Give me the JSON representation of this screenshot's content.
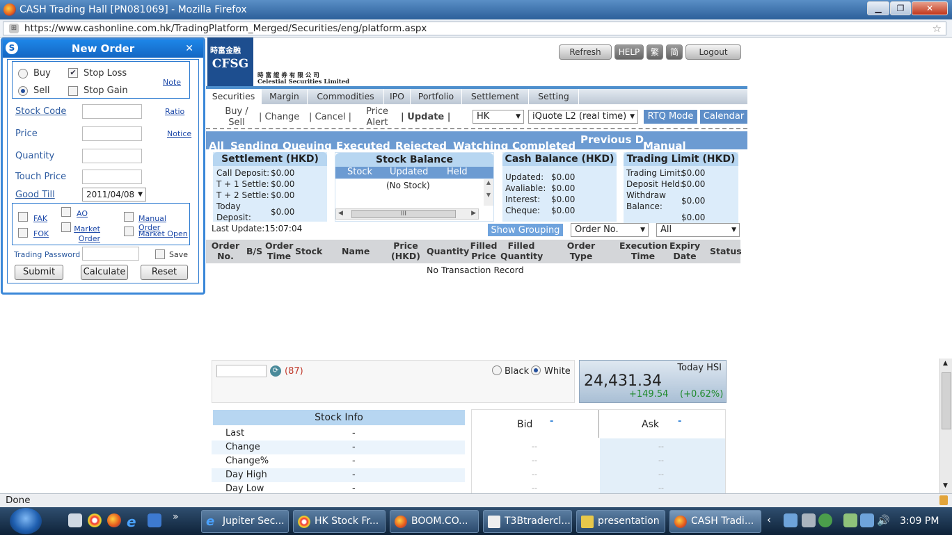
{
  "window": {
    "title": "CASH Trading Hall [PN081069] - Mozilla Firefox",
    "url": "https://www.cashonline.com.hk/TradingPlatform_Merged/Securities/eng/platform.aspx",
    "minimize": "▁",
    "restore": "❐",
    "close": "✕"
  },
  "logo": {
    "text": "CFSG",
    "cn": "時富金融",
    "company_cn": "時 富 證 券 有 限 公 司",
    "company_en": "Celestial Securities Limited"
  },
  "top_buttons": {
    "refresh": "Refresh",
    "help": "HELP",
    "trad": "繁",
    "simp": "简",
    "logout": "Logout"
  },
  "menu": [
    "Securities",
    "Margin",
    "Commodities",
    "IPO",
    "Portfolio",
    "Settlement",
    "Setting"
  ],
  "subbar": {
    "buy_sell": "Buy /\nSell",
    "change": "| Change",
    "cancel": "| Cancel |",
    "price_alert": "Price\nAlert",
    "update": "| Update |",
    "market": "HK",
    "quote": "iQuote L2 (real time)",
    "rtq": "RTQ Mode",
    "calendar": "Calendar"
  },
  "tabs": [
    "All",
    "Sending",
    "Queuing",
    "Executed",
    "Rejected",
    "Watching",
    "Completed",
    "Previous D",
    "Manual"
  ],
  "settlement": {
    "title": "Settlement (HKD)",
    "rows": [
      {
        "label": "Call Deposit:",
        "value": "$0.00"
      },
      {
        "label": "T + 1 Settle:",
        "value": "$0.00"
      },
      {
        "label": "T + 2 Settle:",
        "value": "$0.00"
      },
      {
        "label": "Today\nDeposit:",
        "value": "$0.00"
      }
    ],
    "last_update": "Last Update:15:07:04"
  },
  "stock_balance": {
    "title": "Stock Balance",
    "cols": [
      "Stock",
      "Updated",
      "Held"
    ],
    "empty": "(No Stock)",
    "scroll_mid": "III"
  },
  "cash_balance": {
    "title": "Cash Balance (HKD)",
    "rows": [
      {
        "label": "Updated:",
        "value": "$0.00"
      },
      {
        "label": "Avaliable:",
        "value": "$0.00"
      },
      {
        "label": "Interest:",
        "value": "$0.00"
      },
      {
        "label": "Cheque:",
        "value": "$0.00"
      }
    ]
  },
  "trading_limit": {
    "title": "Trading Limit (HKD)",
    "rows": [
      {
        "label": "Trading Limit:",
        "value": "$0.00"
      },
      {
        "label": "Deposit Held:",
        "value": "$0.00"
      },
      {
        "label": "Withdraw\nBalance:",
        "value": "$0.00"
      },
      {
        "label": "",
        "value": "$0.00"
      }
    ]
  },
  "grouping": {
    "button": "Show Grouping",
    "order_select": "Order No.",
    "filter_select": "All"
  },
  "order_table": {
    "headers": [
      "Order\nNo.",
      "B/S",
      "Order\nTime",
      "Stock",
      "Name",
      "Price\n(HKD)",
      "Quantity",
      "Filled\nPrice",
      "Filled\nQuantity",
      "Order\nType",
      "Execution\nTime",
      "Expiry\nDate",
      "Status"
    ],
    "empty": "No Transaction Record"
  },
  "quote": {
    "count": "(87)",
    "black": "Black",
    "white": "White"
  },
  "hsi": {
    "label": "Today HSI",
    "value": "24,431.34",
    "change": "+149.54",
    "change_pct": "(+0.62%)"
  },
  "stock_info": {
    "title": "Stock Info",
    "rows": [
      {
        "label": "Last",
        "value": "-"
      },
      {
        "label": "Change",
        "value": "-"
      },
      {
        "label": "Change%",
        "value": "-"
      },
      {
        "label": "Day High",
        "value": "-"
      },
      {
        "label": "Day Low",
        "value": "-"
      }
    ]
  },
  "bid_ask": {
    "bid": "Bid",
    "ask": "Ask",
    "bid_val": "-",
    "ask_val": "-",
    "dash": "--"
  },
  "new_order": {
    "title": "New Order",
    "close": "✕",
    "buy": "Buy",
    "sell": "Sell",
    "stop_loss": "Stop Loss",
    "stop_gain": "Stop Gain",
    "note": "Note",
    "stock_code": "Stock Code",
    "ratio": "Ratio",
    "price": "Price",
    "notice": "Notice",
    "quantity": "Quantity",
    "touch_price": "Touch Price",
    "good_till": "Good Till",
    "good_till_value": "2011/04/08",
    "fak": "FAK",
    "ao": "AO",
    "manual_order": "Manual Order",
    "fok": "FOK",
    "market_order": "Market\nOrder",
    "market_open": "Market Open",
    "trading_password": "Trading Password",
    "save": "Save",
    "submit": "Submit",
    "calculate": "Calculate",
    "reset": "Reset"
  },
  "status": {
    "text": "Done"
  },
  "taskbar": {
    "tasks": [
      "Jupiter Sec...",
      "HK Stock Fr...",
      "BOOM.CO...",
      "T3Btradercl...",
      "presentation",
      "CASH Tradi..."
    ],
    "clock": "3:09 PM",
    "more": "»"
  }
}
